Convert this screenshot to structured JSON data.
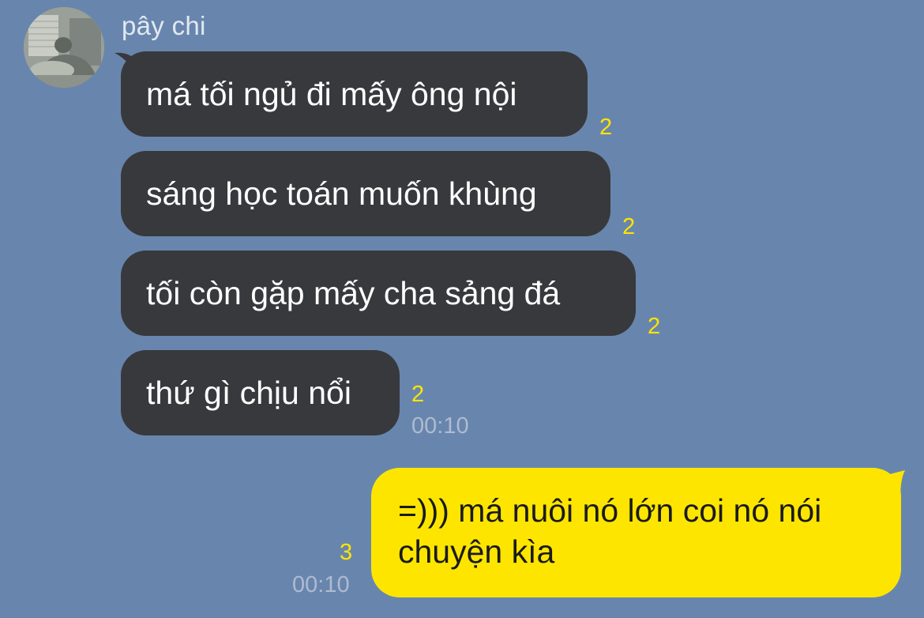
{
  "contact": {
    "name": "pây chi"
  },
  "incoming": {
    "time": "00:10",
    "messages": [
      {
        "text": "má tối ngủ đi mấy ông nội",
        "unread": "2"
      },
      {
        "text": "sáng học toán muốn khùng",
        "unread": "2"
      },
      {
        "text": "tối còn gặp mấy cha sảng đá",
        "unread": "2"
      },
      {
        "text": "thứ gì chịu nổi",
        "unread": "2"
      }
    ]
  },
  "outgoing": {
    "text_line1": "=))) má nuôi nó lớn coi nó nói",
    "text_line2": "chuyện kìa",
    "unread": "3",
    "time": "00:10"
  },
  "colors": {
    "background": "#6886ad",
    "incoming_bubble": "#38393c",
    "outgoing_bubble": "#fee500",
    "unread_count": "#ffe400"
  }
}
